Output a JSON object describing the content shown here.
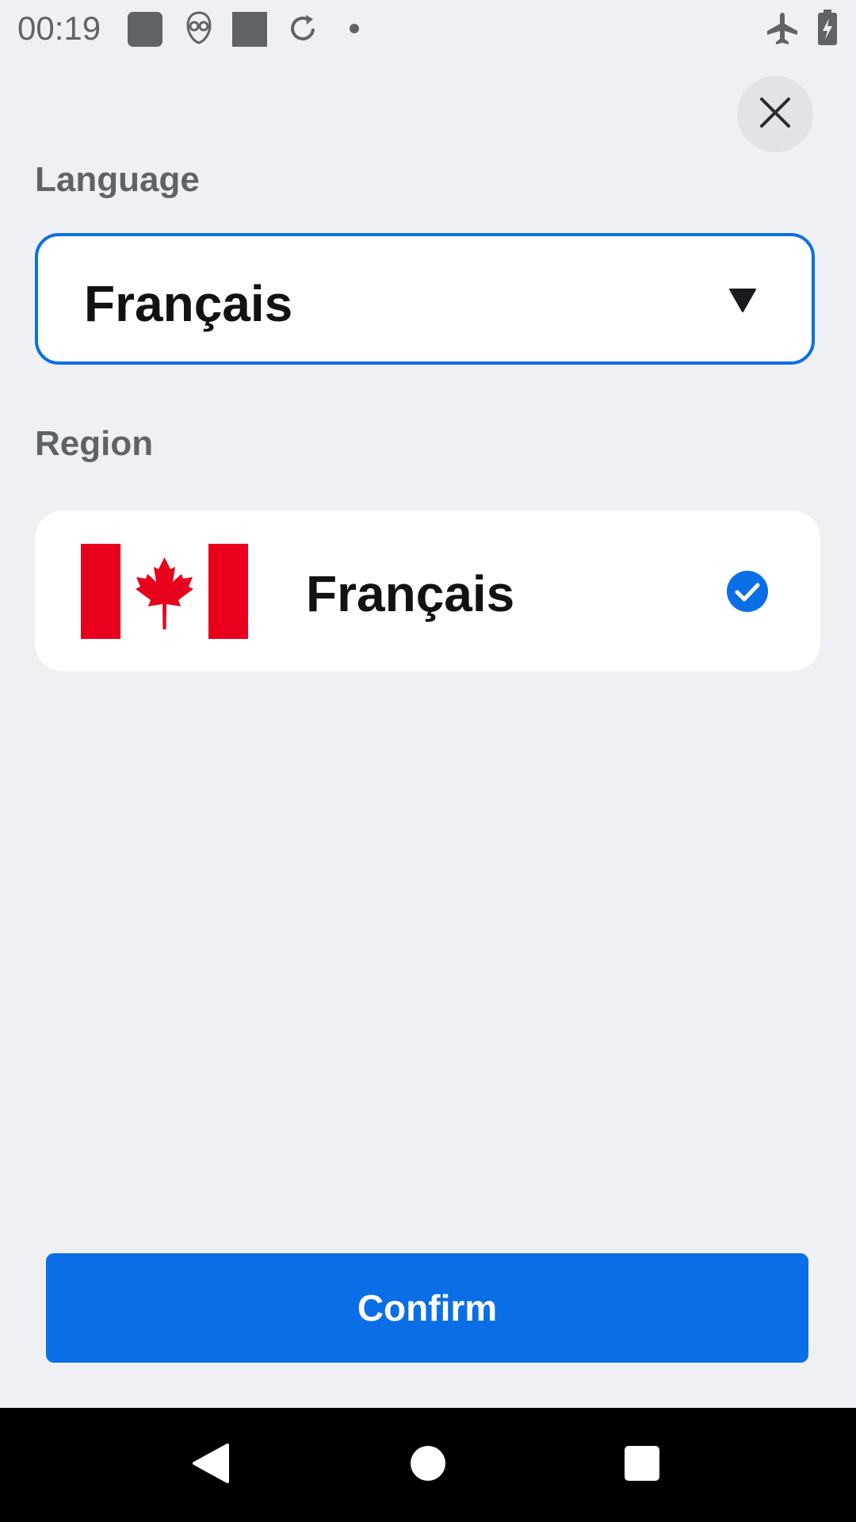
{
  "status_bar": {
    "time": "00:19",
    "icons": [
      "square-notification-icon",
      "alien-app-icon",
      "square-notification-icon",
      "sync-icon",
      "dot-icon",
      "airplane-mode-icon",
      "battery-charging-icon"
    ]
  },
  "header": {
    "close_icon": "close-icon"
  },
  "language": {
    "label": "Language",
    "selected": "Français"
  },
  "region": {
    "label": "Region",
    "item": {
      "flag": "canada-flag",
      "name": "Français",
      "selected": true
    }
  },
  "actions": {
    "confirm_label": "Confirm"
  },
  "colors": {
    "accent": "#0a6fe6",
    "background": "#eff0f3",
    "flag_red": "#e8001c"
  },
  "nav": {
    "buttons": [
      "back-icon",
      "home-icon",
      "recents-icon"
    ]
  }
}
